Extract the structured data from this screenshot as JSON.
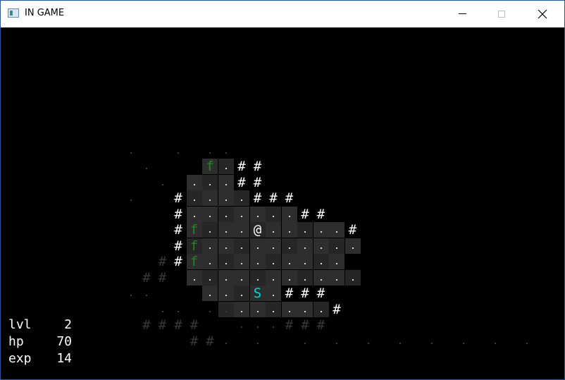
{
  "window": {
    "title": "IN GAME"
  },
  "hud": {
    "lvl_label": "lvl",
    "lvl_value": "2",
    "hp_label": "hp",
    "hp_value": "70",
    "exp_label": "exp",
    "exp_value": "14"
  },
  "glyphs": {
    "player": "@",
    "monster_f": "f",
    "monster_s": "S",
    "wall": "#"
  },
  "colors": {
    "player": "#ffffff",
    "monster_f": "#1f8a1f",
    "monster_s": "#00d8d8",
    "wall": "#ffffff"
  },
  "map": {
    "lit_rows": [
      "  f.##        ",
      " .,,##        ",
      "#....###      ",
      "#.......##    ",
      "#f...@.....#  ",
      "#f..........  ",
      "#f.........   ",
      " ...........  ",
      "  ,..S.###    ",
      "   .......#   "
    ]
  }
}
